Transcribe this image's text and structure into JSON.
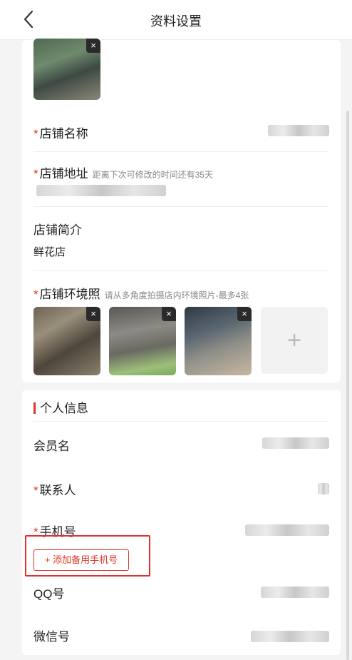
{
  "nav": {
    "title": "资料设置"
  },
  "store": {
    "name_label": "店铺名称",
    "address_label": "店铺地址",
    "address_hint": "距离下次可修改的时间还有35天",
    "intro_label": "店铺简介",
    "intro_value": "鲜花店",
    "env_label": "店铺环境照",
    "env_hint": "请从多角度拍摄店内环境照片-最多4张",
    "add_photo_symbol": "+"
  },
  "personal": {
    "section_title": "个人信息",
    "member_label": "会员名",
    "contact_label": "联系人",
    "phone_label": "手机号",
    "add_backup_phone": "+ 添加备用手机号",
    "qq_label": "QQ号",
    "wechat_label": "微信号"
  },
  "required_mark": "*",
  "close_symbol": "×",
  "colors": {
    "accent": "#e0352b",
    "background": "#f4f4f4"
  }
}
